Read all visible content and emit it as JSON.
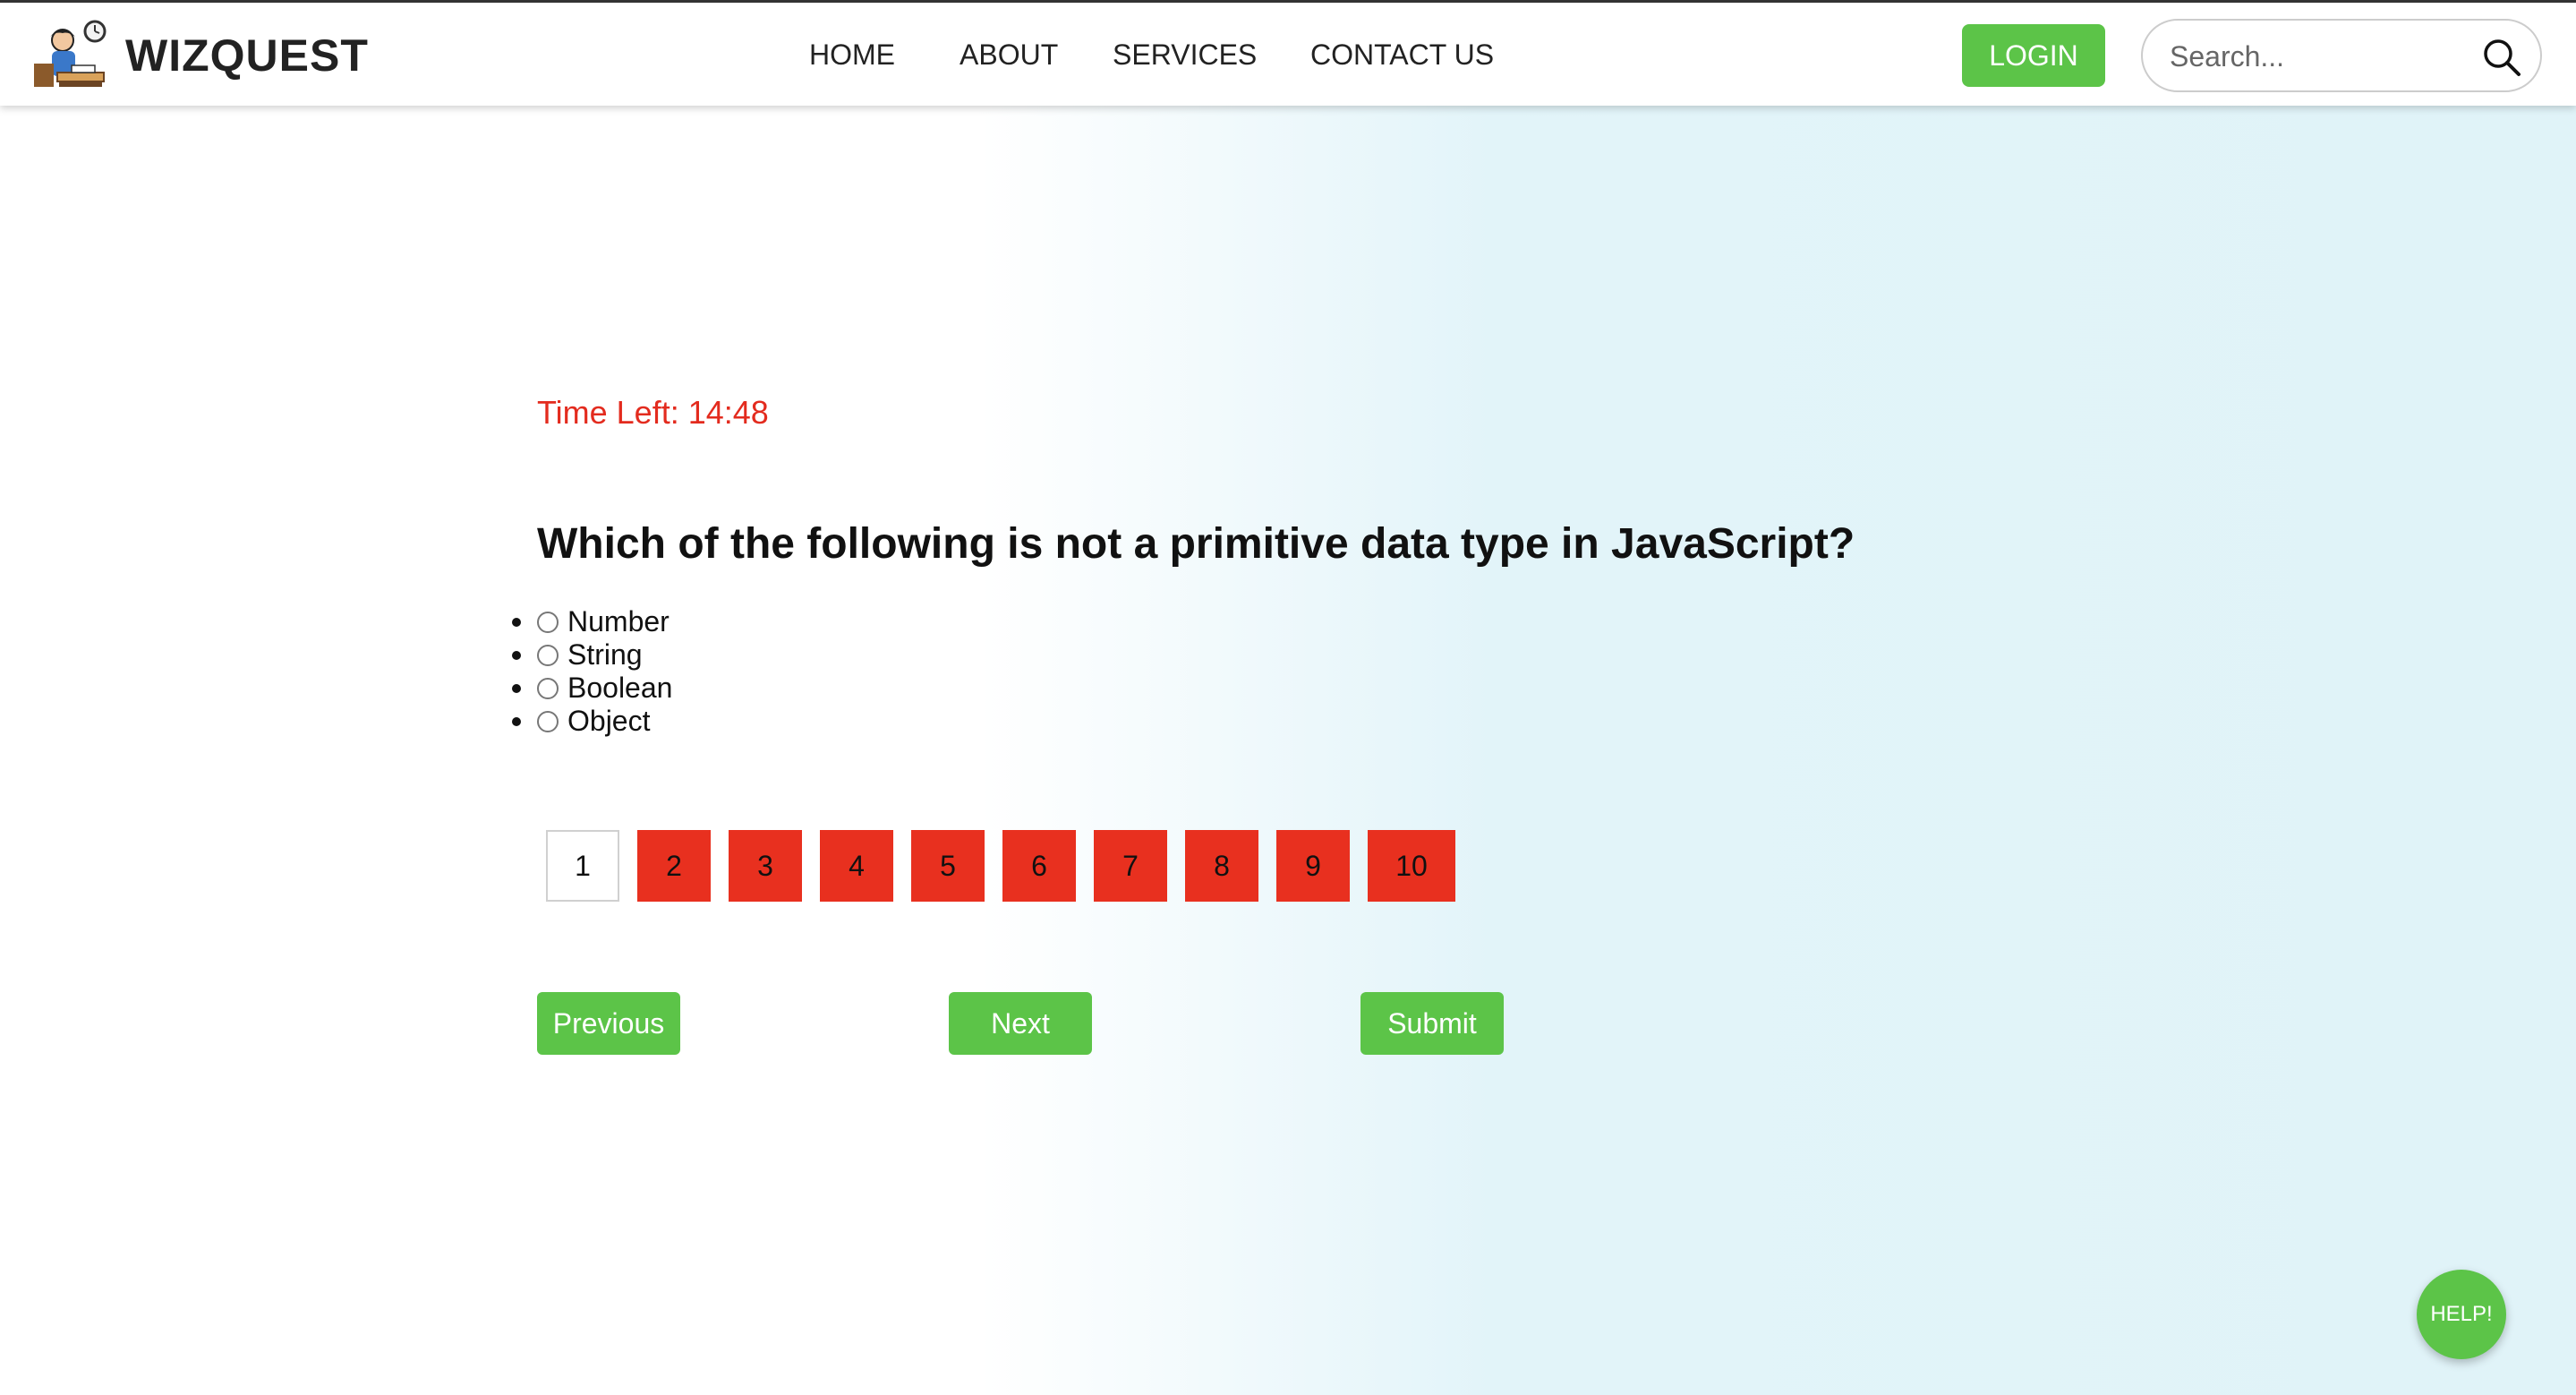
{
  "header": {
    "brand": "WIZQUEST",
    "nav": [
      "HOME",
      "ABOUT",
      "SERVICES",
      "CONTACT US"
    ],
    "login_label": "LOGIN",
    "search_placeholder": "Search..."
  },
  "quiz": {
    "timer": "Time Left: 14:48",
    "question": "Which of the following is not a primitive data type in JavaScript?",
    "options": [
      "Number",
      "String",
      "Boolean",
      "Object"
    ],
    "pages": [
      "1",
      "2",
      "3",
      "4",
      "5",
      "6",
      "7",
      "8",
      "9",
      "10"
    ],
    "current_page": "1",
    "previous_label": "Previous",
    "next_label": "Next",
    "submit_label": "Submit"
  },
  "help_label": "HELP!",
  "colors": {
    "accent_green": "#5cc448",
    "timer_red": "#e32b1e",
    "page_red": "#e8301f"
  }
}
